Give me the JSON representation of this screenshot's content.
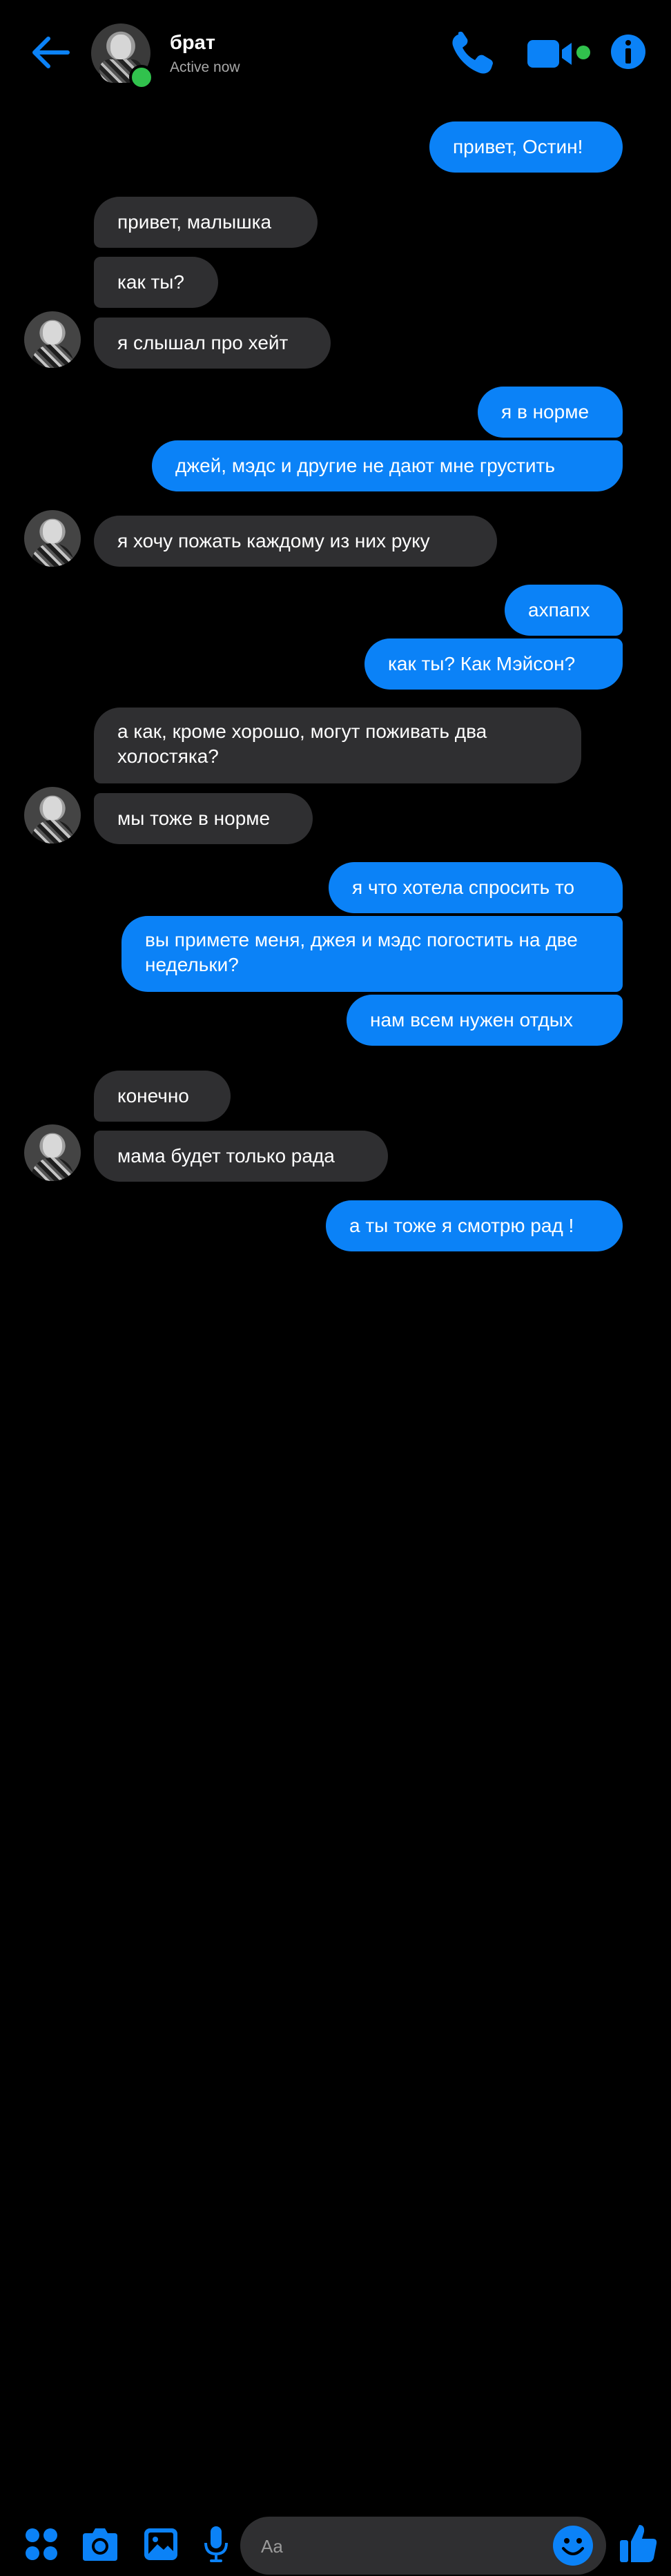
{
  "header": {
    "contact_name": "брат",
    "status": "Active now",
    "icons": [
      "back-arrow-icon",
      "phone-icon",
      "video-camera-icon",
      "info-icon"
    ]
  },
  "messages": [
    {
      "from": "me",
      "text": "привет, Остин!"
    },
    {
      "from": "contact",
      "text": "привет, малышка"
    },
    {
      "from": "contact",
      "text": "как ты?"
    },
    {
      "from": "contact",
      "text": "я слышал про хейт"
    },
    {
      "from": "me",
      "text": "я в норме"
    },
    {
      "from": "me",
      "text": "джей, мэдс и другие не дают мне грустить"
    },
    {
      "from": "contact",
      "text": "я хочу пожать каждому из них руку"
    },
    {
      "from": "me",
      "text": "ахпапх"
    },
    {
      "from": "me",
      "text": "как ты? Как Мэйсон?"
    },
    {
      "from": "contact",
      "text": "а как, кроме хорошо, могут поживать два холостяка?"
    },
    {
      "from": "contact",
      "text": "мы тоже в норме"
    },
    {
      "from": "me",
      "text": "я что хотела спросить то"
    },
    {
      "from": "me",
      "text": "вы примете меня, джея и мэдс погостить на две недельки?"
    },
    {
      "from": "me",
      "text": "нам всем нужен отдых"
    },
    {
      "from": "contact",
      "text": "конечно"
    },
    {
      "from": "contact",
      "text": "мама будет только рада"
    },
    {
      "from": "me",
      "text": "а ты тоже я смотрю рад !"
    }
  ],
  "composer": {
    "placeholder": "Aa",
    "icons": [
      "apps-icon",
      "camera-icon",
      "gallery-icon",
      "microphone-icon",
      "emoji-icon",
      "thumbs-up-icon"
    ]
  },
  "colors": {
    "background": "#000000",
    "accent": "#0b82f7",
    "received_bubble": "#2f2f31",
    "online": "#31c24d"
  }
}
